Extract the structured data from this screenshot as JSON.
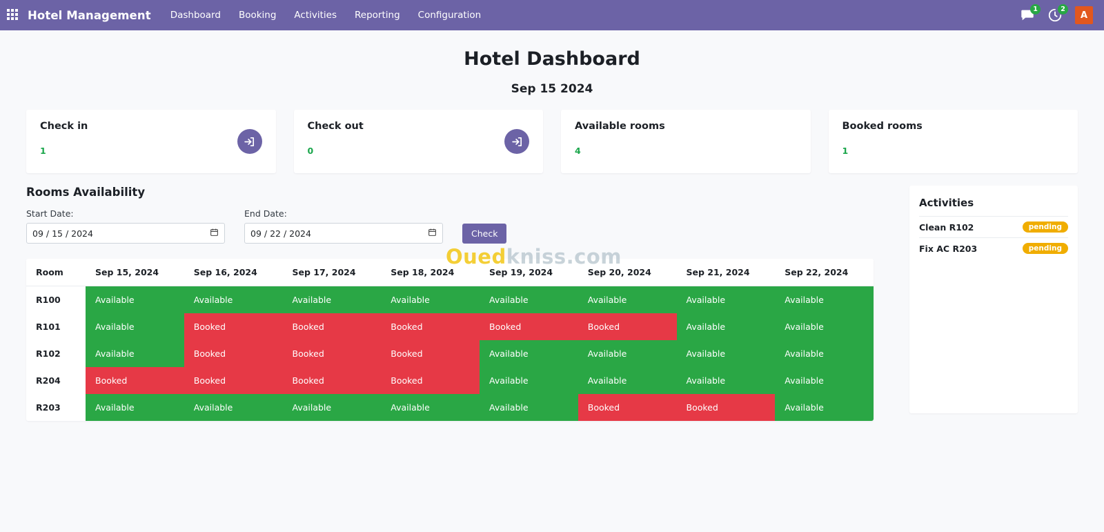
{
  "navbar": {
    "apps_icon": "apps-grid-icon",
    "brand": "Hotel Management",
    "links": [
      {
        "label": "Dashboard"
      },
      {
        "label": "Booking"
      },
      {
        "label": "Activities"
      },
      {
        "label": "Reporting"
      },
      {
        "label": "Configuration"
      }
    ],
    "messages_icon": "chat-bubble-icon",
    "messages_badge": "1",
    "activities_icon": "clock-activity-icon",
    "activities_badge": "2",
    "avatar_initial": "A",
    "accent_color": "#6c63a6",
    "avatar_color": "#e2571e",
    "badge_color": "#28a745"
  },
  "header": {
    "title": "Hotel Dashboard",
    "date": "Sep 15 2024"
  },
  "cards": [
    {
      "title": "Check in",
      "value": "1",
      "icon": "sign-in-icon",
      "has_icon": true
    },
    {
      "title": "Check out",
      "value": "0",
      "icon": "sign-out-icon",
      "has_icon": true
    },
    {
      "title": "Available rooms",
      "value": "4",
      "icon": "",
      "has_icon": false
    },
    {
      "title": "Booked rooms",
      "value": "1",
      "icon": "",
      "has_icon": false
    }
  ],
  "availability": {
    "section_title": "Rooms Availability",
    "start_label": "Start Date:",
    "start_value": "09 / 15 / 2024",
    "end_label": "End Date:",
    "end_value": "09 / 22 / 2024",
    "check_label": "Check",
    "calendar_icon": "calendar-icon",
    "columns": [
      "Room",
      "Sep 15, 2024",
      "Sep 16, 2024",
      "Sep 17, 2024",
      "Sep 18, 2024",
      "Sep 19, 2024",
      "Sep 20, 2024",
      "Sep 21, 2024",
      "Sep 22, 2024"
    ],
    "status_labels": {
      "available": "Available",
      "booked": "Booked"
    },
    "status_colors": {
      "available": "#2aa745",
      "booked": "#e63946"
    },
    "rows": [
      {
        "room": "R100",
        "cells": [
          "Available",
          "Available",
          "Available",
          "Available",
          "Available",
          "Available",
          "Available",
          "Available"
        ]
      },
      {
        "room": "R101",
        "cells": [
          "Available",
          "Booked",
          "Booked",
          "Booked",
          "Booked",
          "Booked",
          "Available",
          "Available"
        ]
      },
      {
        "room": "R102",
        "cells": [
          "Available",
          "Booked",
          "Booked",
          "Booked",
          "Available",
          "Available",
          "Available",
          "Available"
        ]
      },
      {
        "room": "R204",
        "cells": [
          "Booked",
          "Booked",
          "Booked",
          "Booked",
          "Available",
          "Available",
          "Available",
          "Available"
        ]
      },
      {
        "room": "R203",
        "cells": [
          "Available",
          "Available",
          "Available",
          "Available",
          "Available",
          "Booked",
          "Booked",
          "Available"
        ]
      }
    ]
  },
  "activities": {
    "title": "Activities",
    "items": [
      {
        "name": "Clean R102",
        "status": "pending"
      },
      {
        "name": "Fix AC R203",
        "status": "pending"
      }
    ],
    "badge_color": "#f0ad00"
  },
  "watermark": {
    "part1": "Oued",
    "part2": "kniss.com"
  }
}
